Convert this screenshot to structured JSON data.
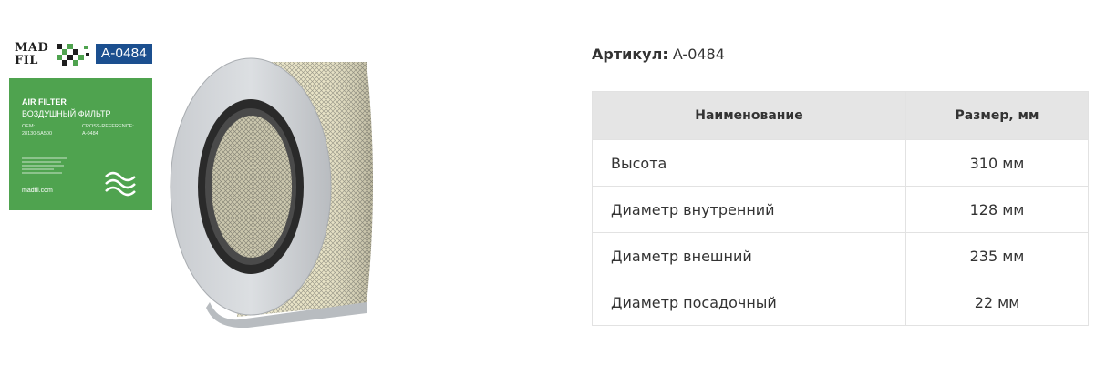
{
  "product_box": {
    "brand_line1": "MAD",
    "brand_line2": "FIL",
    "code": "A-0484",
    "title_en": "AIR FILTER",
    "title_ru": "ВОЗДУШНЫЙ ФИЛЬТР",
    "oem_label": "OEM:",
    "oem_value": "28130-5A500",
    "cross_label": "CROSS-REFERENCE:",
    "cross_value": "A-0484",
    "website": "madfil.com",
    "brand_color": "#1b4f8f",
    "box_color": "#4fa34f"
  },
  "article": {
    "label": "Артикул:",
    "value": "A-0484"
  },
  "specs": {
    "headers": [
      "Наименование",
      "Размер, мм"
    ],
    "rows": [
      {
        "name": "Высота",
        "value": "310 мм"
      },
      {
        "name": "Диаметр внутренний",
        "value": "128 мм"
      },
      {
        "name": "Диаметр внешний",
        "value": "235 мм"
      },
      {
        "name": "Диаметр посадочный",
        "value": "22 мм"
      }
    ]
  }
}
